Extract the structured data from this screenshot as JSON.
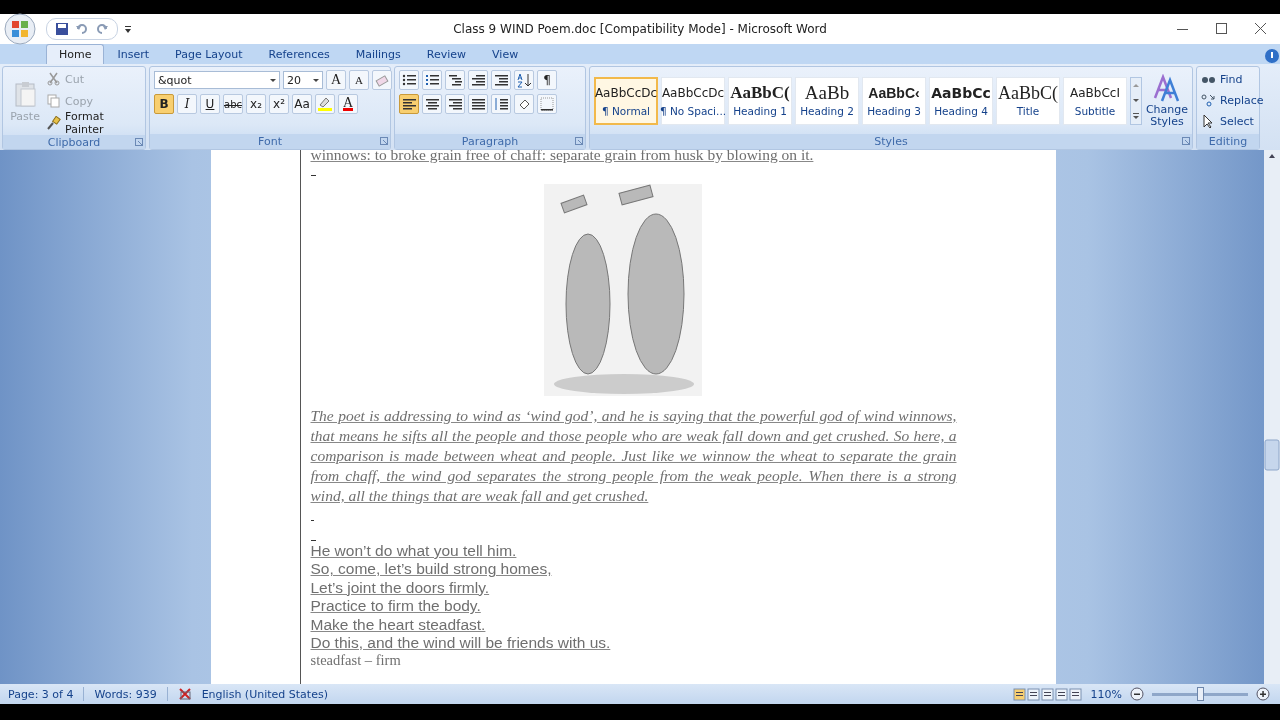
{
  "window": {
    "title": "Class 9 WIND Poem.doc [Compatibility Mode] - Microsoft Word"
  },
  "tabs": [
    {
      "label": "Home",
      "selected": true
    },
    {
      "label": "Insert",
      "selected": false
    },
    {
      "label": "Page Layout",
      "selected": false
    },
    {
      "label": "References",
      "selected": false
    },
    {
      "label": "Mailings",
      "selected": false
    },
    {
      "label": "Review",
      "selected": false
    },
    {
      "label": "View",
      "selected": false
    }
  ],
  "ribbon": {
    "clipboard": {
      "label": "Clipboard",
      "paste": {
        "label": "Paste",
        "disabled": true
      },
      "items": [
        {
          "kind": "cut",
          "label": "Cut",
          "disabled": true
        },
        {
          "kind": "copy",
          "label": "Copy",
          "disabled": true
        },
        {
          "kind": "painter",
          "label": "Format Painter",
          "disabled": false
        }
      ]
    },
    "font": {
      "label": "Font",
      "font_name": "&quot",
      "font_size": "20",
      "grow": "A",
      "shrink": "A",
      "format_buttons": [
        {
          "kind": "bold",
          "label": "B",
          "selected": true
        },
        {
          "kind": "italic",
          "label": "I",
          "selected": false
        },
        {
          "kind": "underline",
          "label": "U",
          "selected": false
        },
        {
          "kind": "strike",
          "label": "abc",
          "selected": false
        },
        {
          "kind": "sub",
          "label": "x₂",
          "selected": false
        },
        {
          "kind": "sup",
          "label": "x²",
          "selected": false
        },
        {
          "kind": "case",
          "label": "Aa",
          "selected": false
        }
      ],
      "color_letter": "A"
    },
    "paragraph": {
      "label": "Paragraph",
      "pilcrow": "¶",
      "alignment": [
        {
          "kind": "left",
          "selected": true
        },
        {
          "kind": "center",
          "selected": false
        },
        {
          "kind": "right",
          "selected": false
        },
        {
          "kind": "justify",
          "selected": false
        }
      ]
    },
    "styles": {
      "label": "Styles",
      "items": [
        {
          "sample": "AaBbCcDc",
          "name": "¶ Normal",
          "kind": "normal",
          "selected": true
        },
        {
          "sample": "AaBbCcDc",
          "name": "¶ No Spaci...",
          "kind": "normal",
          "selected": false
        },
        {
          "sample": "AaBbC(",
          "name": "Heading 1",
          "kind": "h1",
          "selected": false
        },
        {
          "sample": "AaBb",
          "name": "Heading 2",
          "kind": "h2",
          "selected": false
        },
        {
          "sample": "AaBbC‹",
          "name": "Heading 3",
          "kind": "h3",
          "selected": false
        },
        {
          "sample": "AaBbCc",
          "name": "Heading 4",
          "kind": "h4",
          "selected": false
        },
        {
          "sample": "AaBbC(",
          "name": "Title",
          "kind": "title",
          "selected": false
        },
        {
          "sample": "AaBbCcI",
          "name": "Subtitle",
          "kind": "subtitle",
          "selected": false
        }
      ],
      "change_styles": "Change Styles"
    },
    "editing": {
      "label": "Editing",
      "items": [
        "Find",
        "Replace",
        "Select"
      ]
    }
  },
  "document": {
    "top_line": "winnows: to broke grain free of chaff: separate grain from husk by blowing on it.",
    "paragraph": "The poet is addressing to wind as ‘wind god’, and he is saying that the powerful god of wind winnows, that means he sifts all the people and those people who are weak fall down and get crushed. So here, a comparison is made between wheat and people. Just like we winnow the wheat to separate the grain from chaff, the wind god separates the strong people from the weak people. When there is a strong wind, all the things that are weak fall and get crushed.",
    "poem": [
      "He won’t do what you tell him.",
      "So, come, let’s build strong homes,",
      "Let’s joint the doors firmly.",
      "Practice to firm the body.",
      "Make the heart steadfast.",
      "Do this, and the wind will be friends with us."
    ],
    "gloss": "steadfast – firm"
  },
  "status_bar": {
    "page": "Page: 3 of 4",
    "words": "Words: 939",
    "language": "English (United States)",
    "zoom": "110%",
    "zoom_level": {
      "level": 0.5
    }
  }
}
